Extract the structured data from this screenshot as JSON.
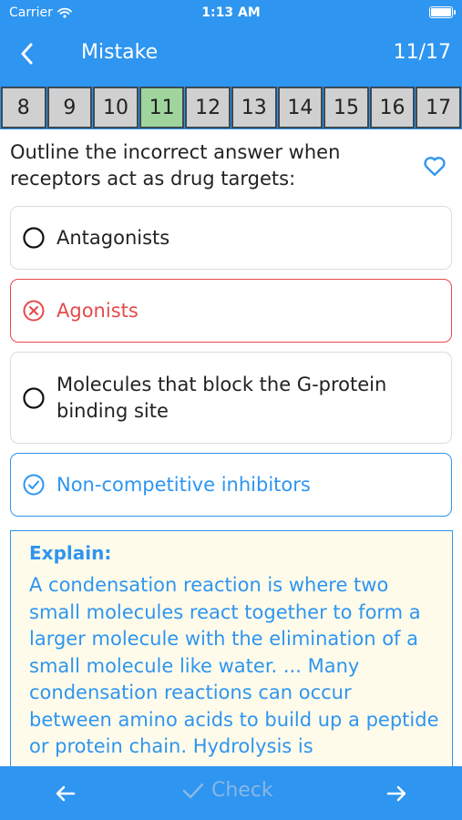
{
  "status_bar": {
    "carrier": "Carrier",
    "time": "1:13 AM"
  },
  "nav": {
    "title": "Mistake",
    "counter": "11/17"
  },
  "tabs": [
    {
      "label": "8",
      "active": false
    },
    {
      "label": "9",
      "active": false
    },
    {
      "label": "10",
      "active": false
    },
    {
      "label": "11",
      "active": true
    },
    {
      "label": "12",
      "active": false
    },
    {
      "label": "13",
      "active": false
    },
    {
      "label": "14",
      "active": false
    },
    {
      "label": "15",
      "active": false
    },
    {
      "label": "16",
      "active": false
    },
    {
      "label": "17",
      "active": false
    }
  ],
  "question": {
    "text": "Outline the incorrect answer when receptors act as drug targets:"
  },
  "options": [
    {
      "label": "Antagonists",
      "state": "unselected"
    },
    {
      "label": "Agonists",
      "state": "wrong"
    },
    {
      "label": "Molecules that block the G-protein binding site",
      "state": "unselected"
    },
    {
      "label": "Non-competitive inhibitors",
      "state": "correct"
    }
  ],
  "explain": {
    "title": "Explain:",
    "body": "A condensation reaction is where two small molecules react together to form a larger molecule with the elimination of a small molecule like water. ... Many condensation reactions can occur between amino acids to build up a peptide or protein chain. Hydrolysis is"
  },
  "footer": {
    "check_label": "Check"
  },
  "colors": {
    "primary": "#2e95f0",
    "wrong": "#e64a4a",
    "active_tab": "#9fd59c",
    "explain_bg": "#fffbea"
  },
  "icons": {
    "back": "chevron-left-icon",
    "favorite": "heart-outline-icon",
    "unselected": "radio-empty-icon",
    "wrong": "x-circle-icon",
    "correct": "check-circle-icon",
    "prev": "arrow-left-icon",
    "next": "arrow-right-icon",
    "check": "checkmark-icon"
  }
}
